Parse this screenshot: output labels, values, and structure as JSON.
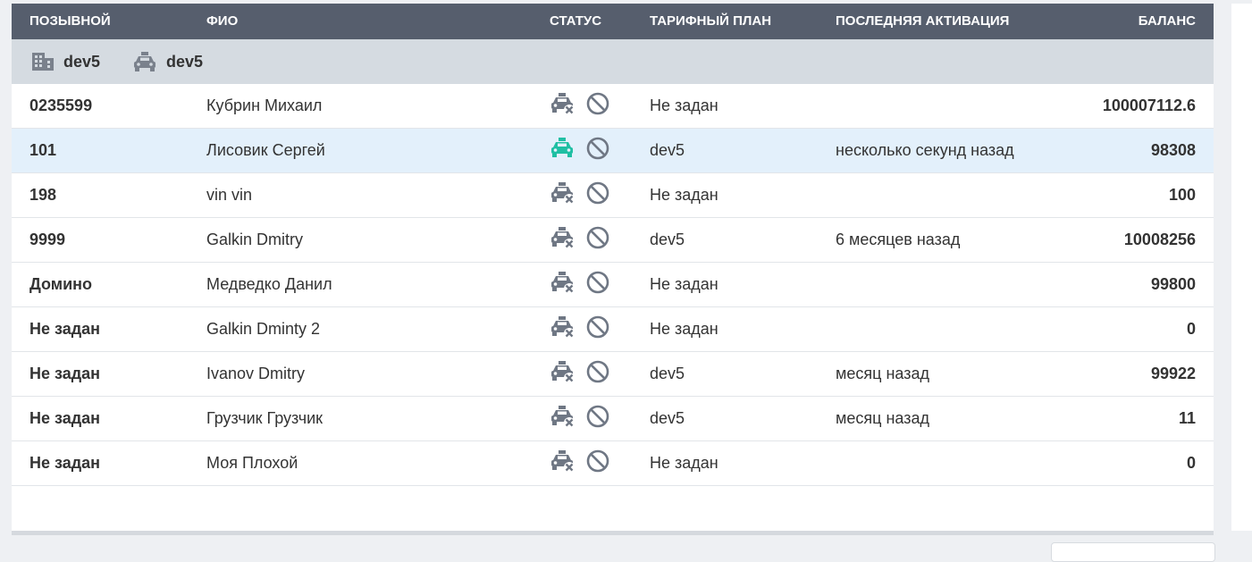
{
  "header": {
    "callsign": "ПОЗЫВНОЙ",
    "name": "ФИО",
    "status": "СТАТУС",
    "tariff": "ТАРИФНЫЙ ПЛАН",
    "last_activation": "ПОСЛЕДНЯЯ АКТИВАЦИЯ",
    "balance": "БАЛАНС"
  },
  "group": {
    "office_label": "dev5",
    "car_label": "dev5"
  },
  "colors": {
    "header_bg": "#565e6d",
    "group_bg": "#d5dbe1",
    "selected_row": "#e3f0fb",
    "online_icon": "#1fbfa3",
    "offline_icon": "#6f7784"
  },
  "rows": [
    {
      "callsign": "0235599",
      "name": "Кубрин Михаил",
      "online": false,
      "tariff": "Не задан",
      "activation": "",
      "balance": "100007112.6"
    },
    {
      "callsign": "101",
      "name": "Лисовик Сергей",
      "online": true,
      "tariff": "dev5",
      "activation": "несколько секунд назад",
      "balance": "98308"
    },
    {
      "callsign": "198",
      "name": "vin vin",
      "online": false,
      "tariff": "Не задан",
      "activation": "",
      "balance": "100"
    },
    {
      "callsign": "9999",
      "name": "Galkin Dmitry",
      "online": false,
      "tariff": "dev5",
      "activation": "6 месяцев назад",
      "balance": "10008256"
    },
    {
      "callsign": "Домино",
      "name": "Медведко Данил",
      "online": false,
      "tariff": "Не задан",
      "activation": "",
      "balance": "99800"
    },
    {
      "callsign": "Не задан",
      "name": "Galkin Dminty 2",
      "online": false,
      "tariff": "Не задан",
      "activation": "",
      "balance": "0"
    },
    {
      "callsign": "Не задан",
      "name": "Ivanov Dmitry",
      "online": false,
      "tariff": "dev5",
      "activation": "месяц назад",
      "balance": "99922"
    },
    {
      "callsign": "Не задан",
      "name": "Грузчик Грузчик",
      "online": false,
      "tariff": "dev5",
      "activation": "месяц назад",
      "balance": "11"
    },
    {
      "callsign": "Не задан",
      "name": "Моя Плохой",
      "online": false,
      "tariff": "Не задан",
      "activation": "",
      "balance": "0"
    }
  ]
}
